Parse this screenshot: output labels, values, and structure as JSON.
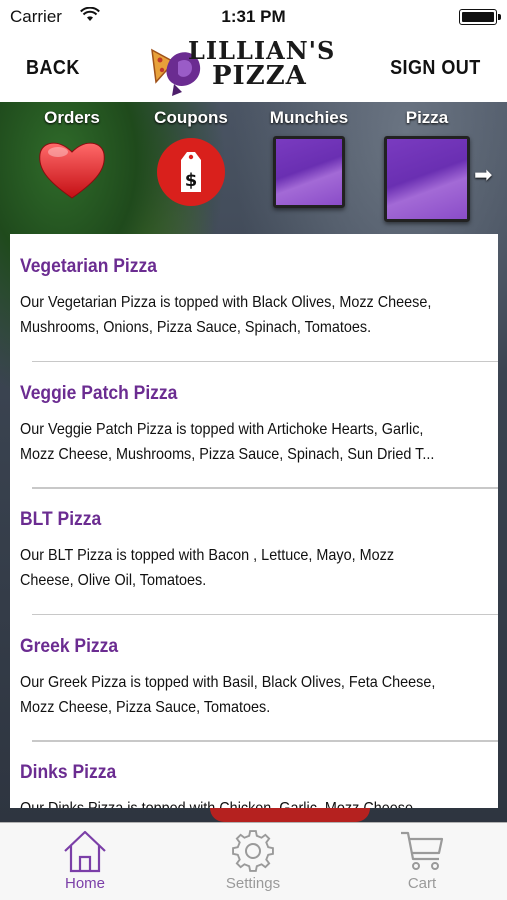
{
  "status_bar": {
    "carrier": "Carrier",
    "time": "1:31 PM"
  },
  "nav": {
    "back_label": "BACK",
    "signout_label": "SIGN OUT",
    "logo_line1": "LILLIAN'S",
    "logo_line2": "PIZZA"
  },
  "categories": [
    {
      "label": "Orders",
      "icon": "heart-icon"
    },
    {
      "label": "Coupons",
      "icon": "price-tag-icon"
    },
    {
      "label": "Munchies",
      "icon": "purple-tile"
    },
    {
      "label": "Pizza",
      "icon": "purple-tile"
    }
  ],
  "next_icon": "arrow-right-icon",
  "menu_items": [
    {
      "title": "Vegetarian Pizza",
      "desc_line1": "Our Vegetarian Pizza is topped with Black Olives, Mozz Cheese,",
      "desc_line2": "Mushrooms, Onions, Pizza Sauce, Spinach, Tomatoes."
    },
    {
      "title": "Veggie Patch Pizza",
      "desc_line1": "Our Veggie Patch Pizza is topped with Artichoke Hearts, Garlic,",
      "desc_line2": "Mozz Cheese, Mushrooms, Pizza Sauce, Spinach, Sun Dried T..."
    },
    {
      "title": "BLT Pizza",
      "desc_line1": "Our BLT Pizza is topped with Bacon , Lettuce, Mayo, Mozz",
      "desc_line2": "Cheese, Olive Oil, Tomatoes."
    },
    {
      "title": "Greek Pizza",
      "desc_line1": "Our Greek Pizza is topped with Basil, Black Olives, Feta Cheese,",
      "desc_line2": "Mozz Cheese, Pizza Sauce, Tomatoes."
    },
    {
      "title": "Dinks Pizza",
      "desc_line1": "Our Dinks Pizza is topped with Chicken, Garlic, Mozz Cheese,",
      "desc_line2": ""
    }
  ],
  "tabbar": {
    "home": "Home",
    "settings": "Settings",
    "cart": "Cart"
  },
  "colors": {
    "brand_purple": "#6b2c91",
    "active_tab": "#7b3fa8",
    "inactive_tab": "#9a9a9a"
  }
}
